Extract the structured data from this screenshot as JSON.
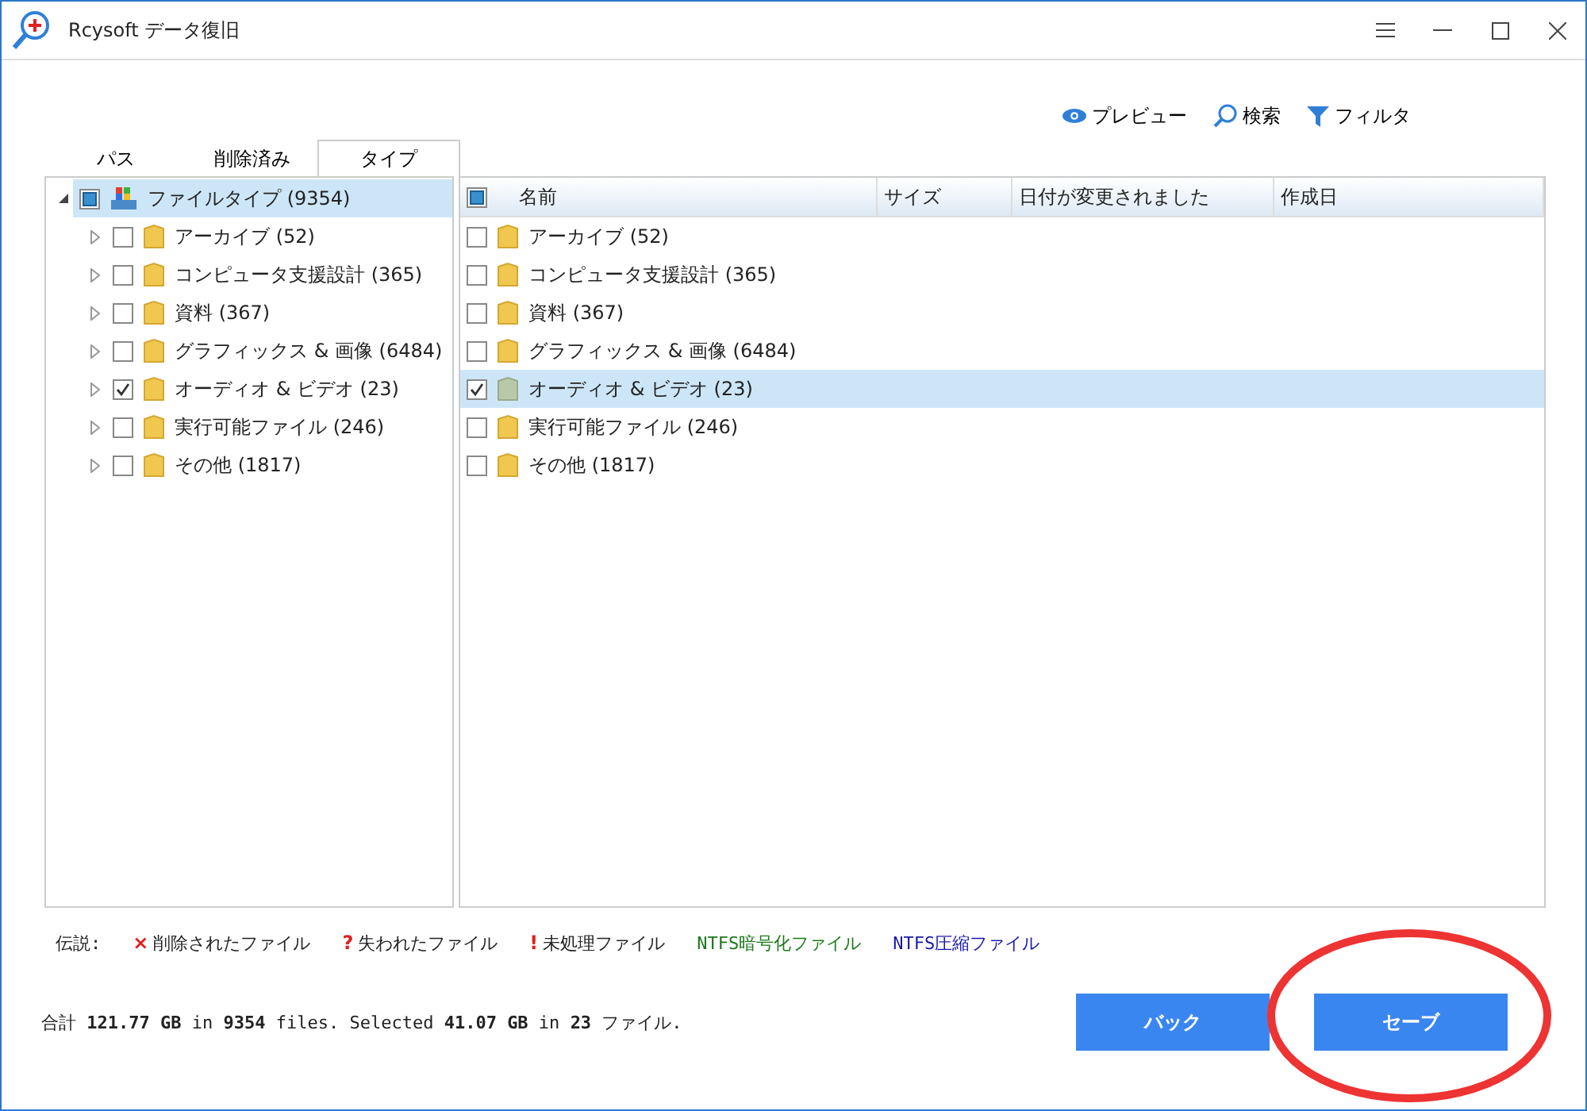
{
  "window": {
    "title": "Rcysoft データ復旧"
  },
  "toolbar": [
    {
      "kind": "preview",
      "label": "プレビュー"
    },
    {
      "kind": "search",
      "label": "検索"
    },
    {
      "kind": "filter",
      "label": "フィルタ"
    }
  ],
  "tabs": [
    {
      "label": "パス",
      "selected": false
    },
    {
      "label": "削除済み",
      "selected": false
    },
    {
      "label": "タイプ",
      "selected": true
    }
  ],
  "tree": {
    "label": "ファイルタイプ (9354)",
    "expanded": true,
    "checked": false,
    "partial": true,
    "selected": true,
    "children": [
      {
        "label": "アーカイブ (52)",
        "checked": false,
        "selected": false
      },
      {
        "label": "コンピュータ支援設計 (365)",
        "checked": false,
        "selected": false
      },
      {
        "label": "資料 (367)",
        "checked": false,
        "selected": false
      },
      {
        "label": "グラフィックス & 画像 (6484)",
        "checked": false,
        "selected": false
      },
      {
        "label": "オーディオ & ビデオ (23)",
        "checked": true,
        "selected": false
      },
      {
        "label": "実行可能ファイル (246)",
        "checked": false,
        "selected": false
      },
      {
        "label": "その他 (1817)",
        "checked": false,
        "selected": false
      }
    ]
  },
  "table": {
    "header_checkbox": {
      "checked": false,
      "partial": true
    },
    "columns": [
      "名前",
      "サイズ",
      "日付が変更されました",
      "作成日"
    ],
    "rows": [
      {
        "name": "アーカイブ (52)",
        "checked": false,
        "selected": false
      },
      {
        "name": "コンピュータ支援設計 (365)",
        "checked": false,
        "selected": false
      },
      {
        "name": "資料 (367)",
        "checked": false,
        "selected": false
      },
      {
        "name": "グラフィックス & 画像 (6484)",
        "checked": false,
        "selected": false
      },
      {
        "name": "オーディオ & ビデオ (23)",
        "checked": true,
        "selected": true
      },
      {
        "name": "実行可能ファイル (246)",
        "checked": false,
        "selected": false
      },
      {
        "name": "その他 (1817)",
        "checked": false,
        "selected": false
      }
    ]
  },
  "legend": {
    "title": "伝説:",
    "items": [
      {
        "kind": "symbol",
        "symbol": "×",
        "label": "削除されたファイル"
      },
      {
        "kind": "symbol",
        "symbol": "?",
        "label": "失われたファイル"
      },
      {
        "kind": "symbol",
        "symbol": "!",
        "label": "未処理ファイル"
      },
      {
        "kind": "colored",
        "label": "NTFS暗号化ファイル",
        "color": "#1a7a1a"
      },
      {
        "kind": "colored",
        "label": "NTFS圧縮ファイル",
        "color": "#1a1aaa"
      }
    ]
  },
  "status_bar": "合計 **121.77 GB** in **9354** files. Selected **41.07 GB** in **23** ファイル.",
  "buttons": [
    {
      "label": "バック"
    },
    {
      "label": "セーブ"
    }
  ]
}
